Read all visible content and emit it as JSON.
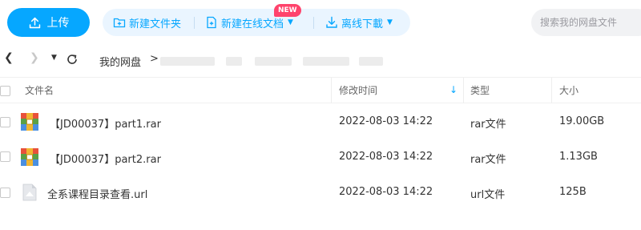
{
  "toolbar": {
    "upload_label": "上传",
    "new_folder_label": "新建文件夹",
    "new_online_doc_label": "新建在线文档",
    "new_badge": "NEW",
    "offline_download_label": "离线下載",
    "search_placeholder": "搜索我的网盘文件"
  },
  "path": {
    "root": "我的网盘",
    "separator": ">"
  },
  "table": {
    "headers": {
      "name": "文件名",
      "modified": "修改时间",
      "type": "类型",
      "size": "大小"
    },
    "rows": [
      {
        "name": "【JD00037】part1.rar",
        "modified": "2022-08-03 14:22",
        "type": "rar文件",
        "size": "19.00GB",
        "icon": "rar-archive-icon"
      },
      {
        "name": "【JD00037】part2.rar",
        "modified": "2022-08-03 14:22",
        "type": "rar文件",
        "size": "1.13GB",
        "icon": "rar-archive-icon"
      },
      {
        "name": "全系课程目录查看.url",
        "modified": "2022-08-03 14:22",
        "type": "url文件",
        "size": "125B",
        "icon": "url-file-icon"
      }
    ]
  },
  "colors": {
    "accent": "#06a7ff",
    "pill_bg": "#eaf5ff",
    "badge": "#ff436c"
  }
}
